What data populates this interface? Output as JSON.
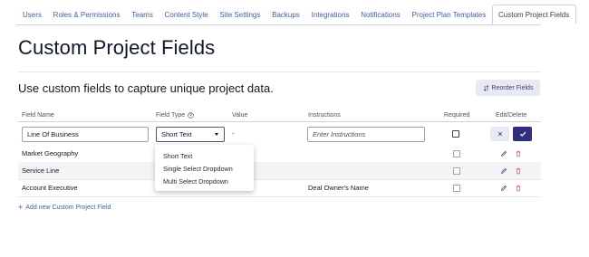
{
  "tabs": [
    {
      "label": "Users"
    },
    {
      "label": "Roles & Permissions"
    },
    {
      "label": "Teams"
    },
    {
      "label": "Content Style"
    },
    {
      "label": "Site Settings"
    },
    {
      "label": "Backups"
    },
    {
      "label": "Integrations"
    },
    {
      "label": "Notifications"
    },
    {
      "label": "Project Plan Templates"
    },
    {
      "label": "Custom Project Fields",
      "active": true
    }
  ],
  "page": {
    "title": "Custom Project Fields",
    "subtitle": "Use custom fields to capture unique project data.",
    "reorder_label": "Reorder Fields",
    "add_label": "Add new Custom Project Field"
  },
  "table": {
    "headers": {
      "field_name": "Field Name",
      "field_type": "Field Type",
      "value": "Value",
      "instructions": "Instructions",
      "required": "Required",
      "edit_delete": "Edit/Delete"
    },
    "edit_row": {
      "field_name_value": "Line Of Business",
      "field_type_value": "Short Text",
      "value": "-",
      "instructions_placeholder": "Enter Instructions",
      "required": false
    },
    "rows": [
      {
        "name": "Market Geography",
        "instructions": "",
        "required": false
      },
      {
        "name": "Service Line",
        "instructions": "",
        "required": false
      },
      {
        "name": "Account Executive",
        "instructions": "Deal Owner's Name",
        "required": false
      }
    ]
  },
  "dropdown": {
    "options": [
      "Short Text",
      "Single Select Dropdown",
      "Multi Select Dropdown"
    ]
  },
  "colors": {
    "link": "#3d5fa3",
    "primary": "#2f2f7d",
    "button_light": "#e8eaf3",
    "delete": "#e05a5a"
  },
  "icons": {
    "help": "help-circle-icon",
    "reorder": "sort-arrows-icon",
    "edit": "pencil-icon",
    "delete": "trash-icon",
    "cancel": "close-icon",
    "save": "check-icon",
    "add": "plus-icon",
    "caret": "caret-down-icon"
  }
}
